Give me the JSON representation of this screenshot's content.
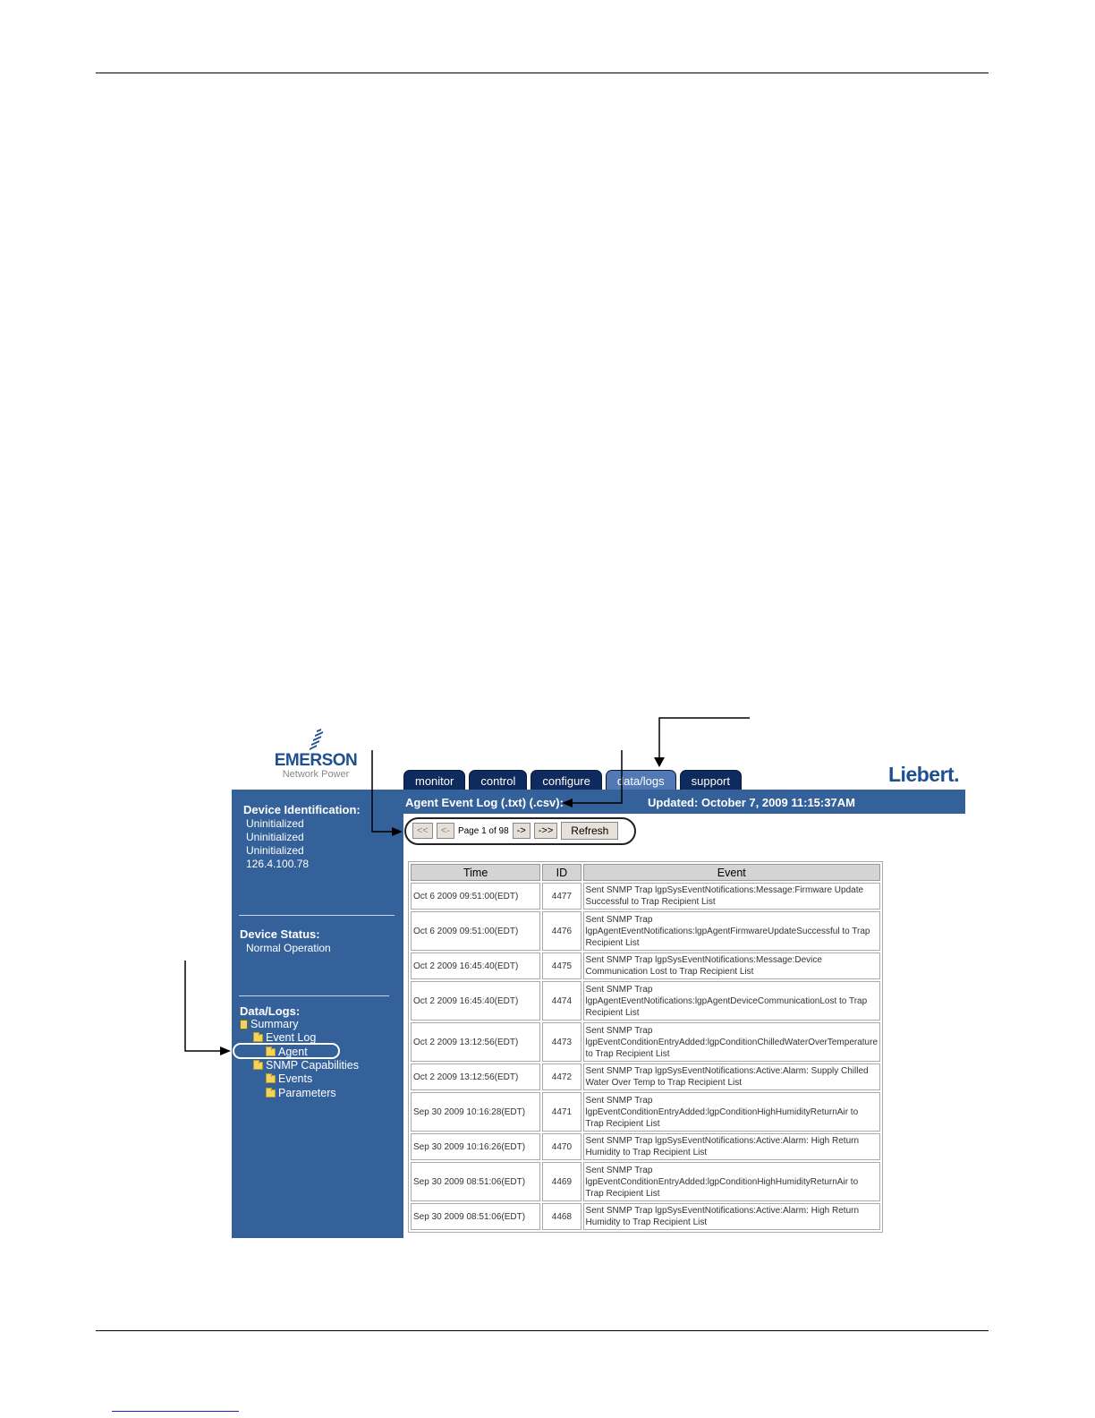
{
  "header": {
    "emerson_logo": "EMERSON",
    "emerson_sub": "Network Power",
    "liebert_logo": "Liebert."
  },
  "tabs": [
    {
      "label": "monitor"
    },
    {
      "label": "control"
    },
    {
      "label": "configure"
    },
    {
      "label": "data/logs",
      "active": true
    },
    {
      "label": "support"
    }
  ],
  "sidebar": {
    "device_identification_heading": "Device Identification:",
    "device_identification": [
      "Uninitialized",
      "Uninitialized",
      "Uninitialized",
      "126.4.100.78"
    ],
    "device_status_heading": "Device Status:",
    "device_status": "Normal Operation",
    "data_logs_heading": "Data/Logs:",
    "tree": {
      "summary": "Summary",
      "event_log": "Event Log",
      "agent": "Agent",
      "snmp_capabilities": "SNMP Capabilities",
      "events": "Events",
      "parameters": "Parameters"
    }
  },
  "titlebar": {
    "title": "Agent Event Log (.txt) (.csv):",
    "updated": "Updated: October 7, 2009 11:15:37AM"
  },
  "pager": {
    "first": "<<",
    "prev": "<-",
    "page_label": "Page 1 of 98",
    "next": "->",
    "last": "->>",
    "refresh": "Refresh"
  },
  "table": {
    "headers": [
      "Time",
      "ID",
      "Event"
    ],
    "rows": [
      {
        "time": "Oct 6 2009 09:51:00(EDT)",
        "id": "4477",
        "event": "Sent SNMP Trap lgpSysEventNotifications:Message:Firmware Update Successful to Trap Recipient List"
      },
      {
        "time": "Oct 6 2009 09:51:00(EDT)",
        "id": "4476",
        "event": "Sent SNMP Trap lgpAgentEventNotifications:lgpAgentFirmwareUpdateSuccessful to Trap Recipient List"
      },
      {
        "time": "Oct 2 2009 16:45:40(EDT)",
        "id": "4475",
        "event": "Sent SNMP Trap lgpSysEventNotifications:Message:Device Communication Lost to Trap Recipient List"
      },
      {
        "time": "Oct 2 2009 16:45:40(EDT)",
        "id": "4474",
        "event": "Sent SNMP Trap lgpAgentEventNotifications:lgpAgentDeviceCommunicationLost to Trap Recipient List"
      },
      {
        "time": "Oct 2 2009 13:12:56(EDT)",
        "id": "4473",
        "event": "Sent SNMP Trap lgpEventConditionEntryAdded:lgpConditionChilledWaterOverTemperature to Trap Recipient List"
      },
      {
        "time": "Oct 2 2009 13:12:56(EDT)",
        "id": "4472",
        "event": "Sent SNMP Trap lgpSysEventNotifications:Active:Alarm: Supply Chilled Water Over Temp to Trap Recipient List"
      },
      {
        "time": "Sep 30 2009 10:16:28(EDT)",
        "id": "4471",
        "event": "Sent SNMP Trap lgpEventConditionEntryAdded:lgpConditionHighHumidityReturnAir to Trap Recipient List"
      },
      {
        "time": "Sep 30 2009 10:16:26(EDT)",
        "id": "4470",
        "event": "Sent SNMP Trap lgpSysEventNotifications:Active:Alarm: High Return Humidity to Trap Recipient List"
      },
      {
        "time": "Sep 30 2009 08:51:06(EDT)",
        "id": "4469",
        "event": "Sent SNMP Trap lgpEventConditionEntryAdded:lgpConditionHighHumidityReturnAir to Trap Recipient List"
      },
      {
        "time": "Sep 30 2009 08:51:06(EDT)",
        "id": "4468",
        "event": "Sent SNMP Trap lgpSysEventNotifications:Active:Alarm: High Return Humidity to Trap Recipient List"
      }
    ]
  },
  "colors": {
    "nav_blue": "#34619a",
    "tab_dark": "#0f2a5c",
    "tab_active": "#5279b3",
    "brand_blue": "#1d4f91"
  }
}
